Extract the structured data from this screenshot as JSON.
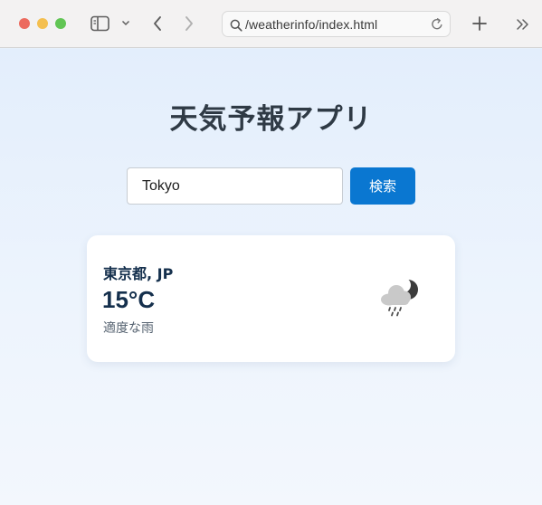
{
  "browser": {
    "url": "/weatherinfo/index.html"
  },
  "app": {
    "title": "天気予報アプリ",
    "search": {
      "value": "Tokyo",
      "button_label": "検索"
    },
    "weather": {
      "location": "東京都, JP",
      "temperature": "15°C",
      "description": "適度な雨",
      "icon": "rain-cloud-night-icon"
    }
  },
  "colors": {
    "accent": "#0a77d1",
    "text_dark": "#15304d",
    "background": "#e6f0fb"
  }
}
